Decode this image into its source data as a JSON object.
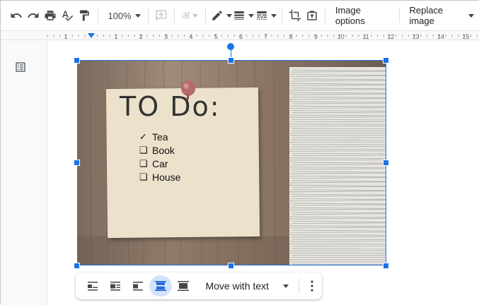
{
  "toolbar": {
    "zoom": "100%",
    "image_options_label": "Image options",
    "replace_image_label": "Replace image",
    "icons": [
      "undo-icon",
      "redo-icon",
      "print-icon",
      "spellcheck-icon",
      "paint-format-icon",
      "insert-comment-icon",
      "input-tools-icon",
      "border-color-icon",
      "border-weight-icon",
      "border-dash-icon",
      "crop-icon",
      "reset-image-icon"
    ]
  },
  "ruler": {
    "numbers": [
      "1",
      "1",
      "2",
      "3",
      "4",
      "5",
      "6",
      "7",
      "8",
      "9",
      "10",
      "11",
      "12",
      "13",
      "14",
      "15"
    ]
  },
  "image": {
    "note_title": "TO Do:",
    "todo": [
      {
        "mark": "✓",
        "label": "Tea"
      },
      {
        "mark": "❑",
        "label": "Book"
      },
      {
        "mark": "❑",
        "label": "Car"
      },
      {
        "mark": "❑",
        "label": "House"
      }
    ]
  },
  "image_bar": {
    "wrap_options": [
      "in-line",
      "wrap-text",
      "break-text",
      "behind-text",
      "in-front-of-text"
    ],
    "active_wrap": "behind-text",
    "move_option": "Move with text"
  },
  "colors": {
    "accent": "#1a73e8",
    "active_bg": "#d3e3fd"
  }
}
